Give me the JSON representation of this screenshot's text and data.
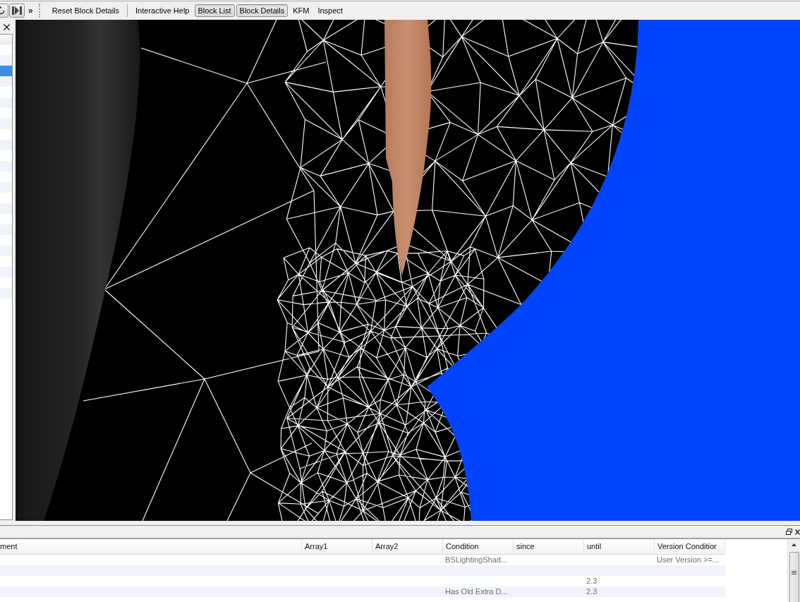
{
  "toolbar": {
    "overflow": "»",
    "groups": [
      {
        "items": [
          {
            "label": "Reset Block Details",
            "checked": false
          }
        ]
      },
      {
        "items": [
          {
            "label": "Interactive Help",
            "checked": false
          },
          {
            "label": "Block List",
            "checked": true
          },
          {
            "label": "Block Details",
            "checked": true
          },
          {
            "label": "KFM",
            "checked": false
          },
          {
            "label": "Inspect",
            "checked": false
          }
        ]
      }
    ]
  },
  "block_list": {
    "rows": [
      {
        "selected": false
      },
      {
        "selected": false
      },
      {
        "selected": true
      },
      {
        "selected": false
      },
      {
        "selected": false
      },
      {
        "selected": false
      },
      {
        "selected": false
      },
      {
        "selected": false
      },
      {
        "selected": false
      },
      {
        "selected": false
      },
      {
        "selected": false
      },
      {
        "selected": false
      },
      {
        "selected": false
      },
      {
        "selected": false
      },
      {
        "selected": false
      },
      {
        "selected": false
      },
      {
        "selected": false
      },
      {
        "selected": false
      },
      {
        "selected": false
      },
      {
        "selected": false
      },
      {
        "selected": false
      },
      {
        "selected": false
      },
      {
        "selected": false
      },
      {
        "selected": false
      },
      {
        "selected": false
      }
    ]
  },
  "details_table": {
    "columns": [
      "ment",
      "Array1",
      "Array2",
      "Condition",
      "since",
      "until",
      "Version Conditior"
    ],
    "rows": [
      {
        "condition": "BSLightingShad...",
        "version_condition": "User Version >=..."
      },
      {},
      {
        "until": "2.3"
      },
      {
        "condition": "Has Old Extra D...",
        "until": "2.3"
      }
    ]
  }
}
